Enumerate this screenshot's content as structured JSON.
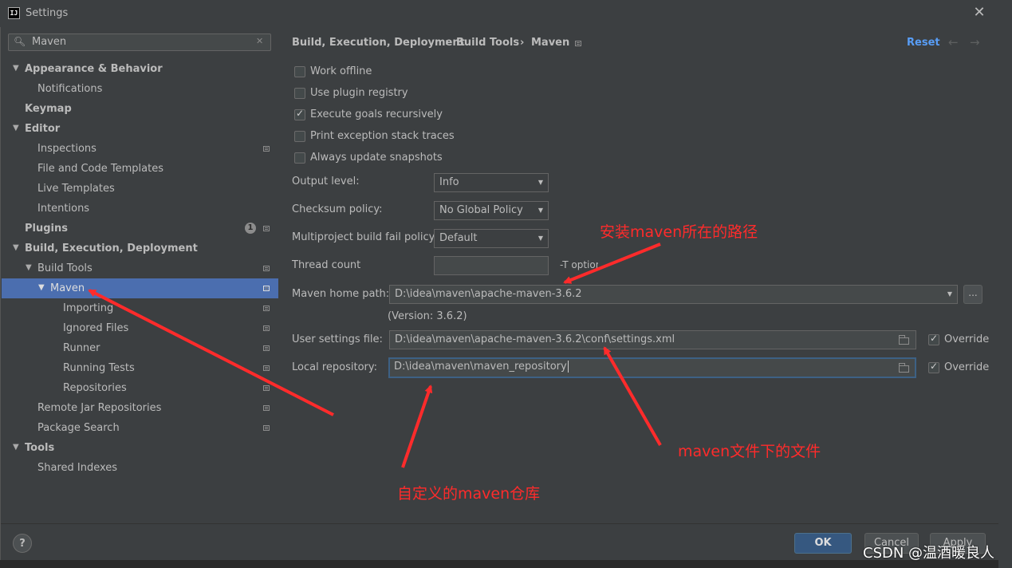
{
  "window": {
    "title": "Settings",
    "app_icon_text": "IJ"
  },
  "search": {
    "value": "Maven"
  },
  "tree": {
    "appearance": "Appearance & Behavior",
    "notifications": "Notifications",
    "keymap": "Keymap",
    "editor": "Editor",
    "inspections": "Inspections",
    "file_templates": "File and Code Templates",
    "live_templates": "Live Templates",
    "intentions": "Intentions",
    "plugins": "Plugins",
    "plugins_badge": "1",
    "build": "Build, Execution, Deployment",
    "build_tools": "Build Tools",
    "maven": "Maven",
    "importing": "Importing",
    "ignored_files": "Ignored Files",
    "runner": "Runner",
    "running_tests": "Running Tests",
    "repositories": "Repositories",
    "remote_jar": "Remote Jar Repositories",
    "package_search": "Package Search",
    "tools": "Tools",
    "shared_indexes": "Shared Indexes"
  },
  "breadcrumb": {
    "part1": "Build, Execution, Deployment",
    "sep": "›",
    "part2": "Build Tools",
    "part3": "Maven"
  },
  "header": {
    "reset": "Reset",
    "back": "←",
    "forward": "→"
  },
  "options": {
    "work_offline": {
      "label": "Work offline",
      "checked": false
    },
    "plugin_registry": {
      "label": "Use plugin registry",
      "checked": false
    },
    "execute_goals": {
      "label": "Execute goals recursively",
      "checked": true
    },
    "print_exception": {
      "label": "Print exception stack traces",
      "checked": false
    },
    "always_update": {
      "label": "Always update snapshots",
      "checked": false
    }
  },
  "fields": {
    "output_level_label": "Output level:",
    "output_level_value": "Info",
    "checksum_label": "Checksum policy:",
    "checksum_value": "No Global Policy",
    "multiproject_label": "Multiproject build fail policy:",
    "multiproject_value": "Default",
    "thread_count_label": "Thread count",
    "thread_count_value": "",
    "thread_count_hint": "-T option",
    "maven_home_label": "Maven home path:",
    "maven_home_value": "D:\\idea\\maven\\apache-maven-3.6.2",
    "maven_home_browse": "...",
    "version": "(Version: 3.6.2)",
    "user_settings_label": "User settings file:",
    "user_settings_value": "D:\\idea\\maven\\apache-maven-3.6.2\\conf\\settings.xml",
    "user_settings_override": "Override",
    "local_repo_label": "Local repository:",
    "local_repo_value": "D:\\idea\\maven\\maven_repository",
    "local_repo_override": "Override"
  },
  "footer": {
    "help": "?",
    "ok": "OK",
    "cancel": "Cancel",
    "apply": "Apply"
  },
  "annotations": {
    "home_path_note": "安装maven所在的路径",
    "settings_note": "maven文件下的文件",
    "repo_note": "自定义的maven仓库"
  },
  "watermark": "CSDN @温酒暖良人",
  "colors": {
    "selection": "#4b6eaf",
    "link": "#589df6",
    "annotation": "#ff2b2b",
    "ok_button": "#365880"
  }
}
